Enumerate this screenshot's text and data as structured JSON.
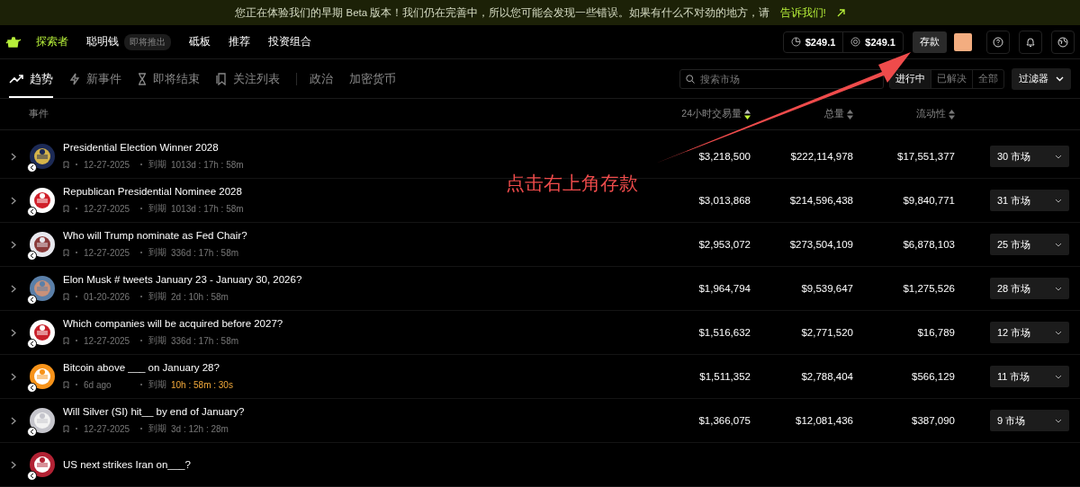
{
  "banner": {
    "message": "您正在体验我们的早期 Beta 版本！我们仍在完善中，所以您可能会发现一些错误。如果有什么不对劲的地方，请",
    "link": "告诉我们!"
  },
  "nav": {
    "items": [
      {
        "label": "探索者",
        "selected": true
      },
      {
        "label": "聪明钱",
        "selected": false,
        "badge": "即将推出"
      },
      {
        "label": "砥板",
        "selected": false
      },
      {
        "label": "推荐",
        "selected": false
      },
      {
        "label": "投资组合",
        "selected": false
      }
    ],
    "balances": [
      {
        "kind": "portfolio",
        "amount": "$249.1"
      },
      {
        "kind": "cash",
        "amount": "$249.1"
      }
    ],
    "deposit_button": "存款"
  },
  "tabs": [
    {
      "label": "趋势",
      "selected": true
    },
    {
      "label": "新事件",
      "selected": false
    },
    {
      "label": "即将结束",
      "selected": false
    },
    {
      "label": "关注列表",
      "selected": false
    }
  ],
  "categories": [
    {
      "label": "政治",
      "selected": false
    },
    {
      "label": "加密货币",
      "selected": false
    }
  ],
  "search": {
    "placeholder": "搜索市场"
  },
  "status_filter": [
    {
      "label": "进行中",
      "selected": true
    },
    {
      "label": "已解决",
      "selected": false
    },
    {
      "label": "全部",
      "selected": false
    }
  ],
  "filter_button": "过滤器",
  "table": {
    "columns": [
      {
        "label": "事件"
      },
      {
        "label": "24小时交易量",
        "sorted": true
      },
      {
        "label": "总量",
        "sorted": false
      },
      {
        "label": "流动性",
        "sorted": false
      }
    ],
    "rows": [
      {
        "title": "Presidential Election Winner 2028",
        "created": "12-27-2025",
        "expiry_label": "到期",
        "expiry": "1013d : 17h : 58m",
        "urgent": false,
        "volume_24h": "$3,218,500",
        "volume_total": "$222,114,978",
        "liquidity": "$17,551,377",
        "markets": "30 市场"
      },
      {
        "title": "Republican Presidential Nominee 2028",
        "created": "12-27-2025",
        "expiry_label": "到期",
        "expiry": "1013d : 17h : 58m",
        "urgent": false,
        "volume_24h": "$3,013,868",
        "volume_total": "$214,596,438",
        "liquidity": "$9,840,771",
        "markets": "31 市场"
      },
      {
        "title": "Who will Trump nominate as Fed Chair?",
        "created": "12-27-2025",
        "expiry_label": "到期",
        "expiry": "336d : 17h : 58m",
        "urgent": false,
        "volume_24h": "$2,953,072",
        "volume_total": "$273,504,109",
        "liquidity": "$6,878,103",
        "markets": "25 市场"
      },
      {
        "title": "Elon Musk # tweets January 23 - January 30, 2026?",
        "created": "01-20-2026",
        "expiry_label": "到期",
        "expiry": "2d : 10h : 58m",
        "urgent": false,
        "volume_24h": "$1,964,794",
        "volume_total": "$9,539,647",
        "liquidity": "$1,275,526",
        "markets": "28 市场"
      },
      {
        "title": "Which companies will be acquired before 2027?",
        "created": "12-27-2025",
        "expiry_label": "到期",
        "expiry": "336d : 17h : 58m",
        "urgent": false,
        "volume_24h": "$1,516,632",
        "volume_total": "$2,771,520",
        "liquidity": "$16,789",
        "markets": "12 市场"
      },
      {
        "title": "Bitcoin above ___ on January 28?",
        "created": "6d ago",
        "expiry_label": "到期",
        "expiry": "10h : 58m : 30s",
        "urgent": true,
        "volume_24h": "$1,511,352",
        "volume_total": "$2,788,404",
        "liquidity": "$566,129",
        "markets": "11 市场"
      },
      {
        "title": "Will Silver (SI) hit__ by end of January?",
        "created": "12-27-2025",
        "expiry_label": "到期",
        "expiry": "3d : 12h : 28m",
        "urgent": false,
        "volume_24h": "$1,366,075",
        "volume_total": "$12,081,436",
        "liquidity": "$387,090",
        "markets": "9 市场"
      },
      {
        "title": "US next strikes Iran on___?"
      }
    ]
  },
  "annotation": {
    "text": "点击右上角存款"
  }
}
